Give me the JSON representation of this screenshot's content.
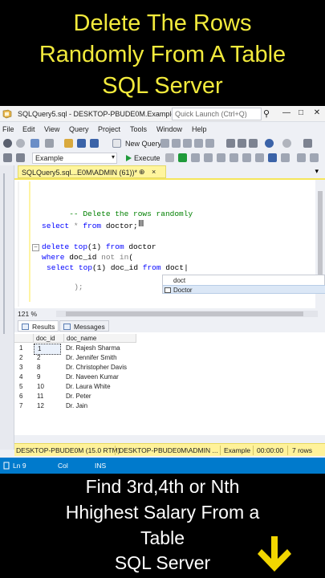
{
  "banner_top": {
    "line1": "Delete The Rows",
    "line2": "Randomly From A Table",
    "line3": "SQL Server",
    "color": "#f2ea3c"
  },
  "window": {
    "title": "SQLQuery5.sql - DESKTOP-PBUDE0M.Example...",
    "quick_launch_placeholder": "Quick Launch (Ctrl+Q)",
    "minimize_glyph": "—",
    "restore_glyph": "□",
    "close_glyph": "✕"
  },
  "menu": [
    "File",
    "Edit",
    "View",
    "Query",
    "Project",
    "Tools",
    "Window",
    "Help"
  ],
  "toolbar": {
    "new_query_label": "New Query",
    "database": "Example",
    "execute_label": "Execute"
  },
  "tab": {
    "label": "SQLQuery5.sql...E0M\\ADMIN (61))*",
    "pin_glyph": "⊕",
    "close_glyph": "×",
    "menu_glyph": "▾"
  },
  "editor": {
    "comment": "-- Delete the rows randomly",
    "line_select": {
      "kw1": "select",
      "mid": " * ",
      "kw2": "from",
      "rest": " doctor;"
    },
    "line_delete": {
      "kw1": "delete",
      "kw2": " top",
      "mid": "(1) ",
      "kw3": "from",
      "rest": " doctor"
    },
    "line_where": {
      "kw1": "where",
      "mid": " doc_id ",
      "kw2": "not in",
      "rest": "("
    },
    "line_sub": {
      "kw1": "select",
      "kw2": " top",
      "mid": "(1) doc_id ",
      "kw3": "from",
      "rest": " doct"
    },
    "line_close": ");",
    "collapse_glyph": "−"
  },
  "autocomplete": {
    "typed": "doct",
    "suggestion": "Doctor"
  },
  "zoom": "121 %",
  "results_tabs": {
    "results": "Results",
    "messages": "Messages"
  },
  "grid": {
    "columns": [
      "doc_id",
      "doc_name"
    ],
    "rows": [
      {
        "n": "1",
        "doc_id": "1",
        "doc_name": "Dr. Rajesh Sharma"
      },
      {
        "n": "2",
        "doc_id": "2",
        "doc_name": "Dr. Jennifer Smith"
      },
      {
        "n": "3",
        "doc_id": "8",
        "doc_name": "Dr. Christopher Davis"
      },
      {
        "n": "4",
        "doc_id": "9",
        "doc_name": "Dr. Naveen Kumar"
      },
      {
        "n": "5",
        "doc_id": "10",
        "doc_name": "Dr. Laura White"
      },
      {
        "n": "6",
        "doc_id": "11",
        "doc_name": "Dr. Peter"
      },
      {
        "n": "7",
        "doc_id": "12",
        "doc_name": "Dr. Jain"
      }
    ]
  },
  "query_status": {
    "server": "DESKTOP-PBUDE0M (15.0 RTM)",
    "user": "DESKTOP-PBUDE0M\\ADMIN ...",
    "database": "Example",
    "time": "00:00:00",
    "rows": "7 rows"
  },
  "status_bar": {
    "ln": "Ln 9",
    "col": "Col",
    "ins": "INS"
  },
  "banner_bottom": {
    "line1": "Find 3rd,4th or Nth",
    "line2": "Hhighest Salary From a",
    "line3": "Table",
    "line4": "SQL Server",
    "arrow_color": "#f2d600"
  }
}
